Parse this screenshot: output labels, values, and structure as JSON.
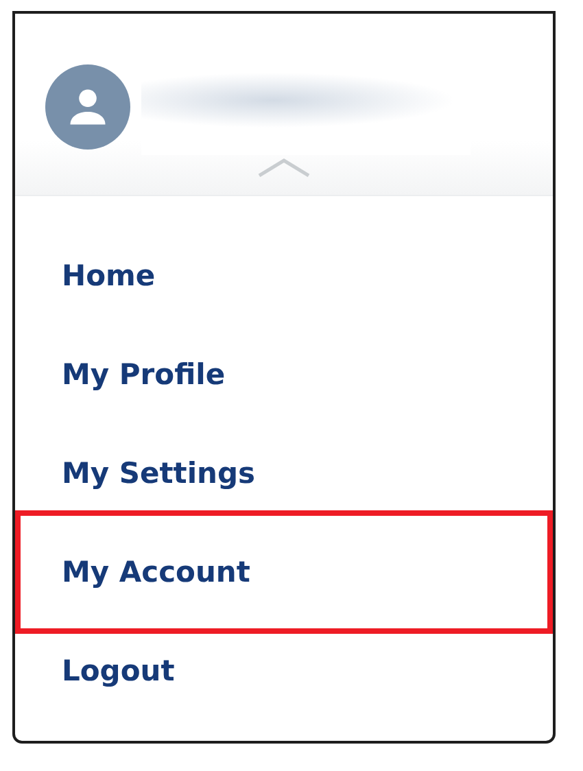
{
  "menu": {
    "items": [
      {
        "label": "Home",
        "selected": false
      },
      {
        "label": "My Profile",
        "selected": false
      },
      {
        "label": "My Settings",
        "selected": false
      },
      {
        "label": "My Account",
        "selected": true
      },
      {
        "label": "Logout",
        "selected": false
      }
    ]
  }
}
